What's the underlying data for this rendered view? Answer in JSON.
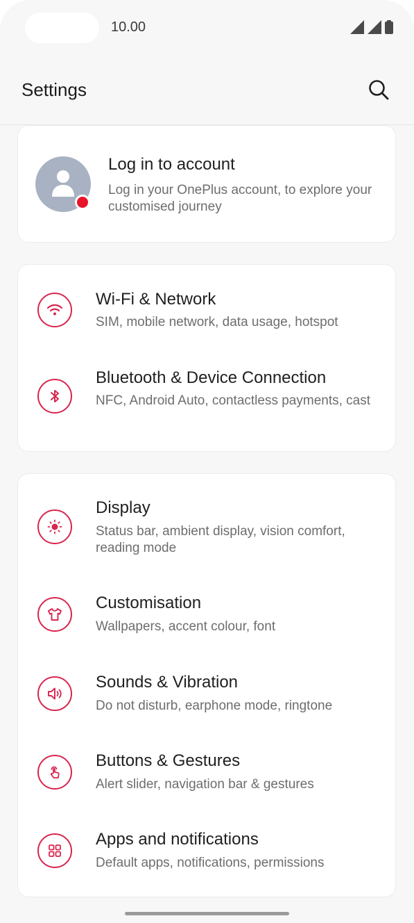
{
  "status_bar": {
    "time": "10.00"
  },
  "header": {
    "title": "Settings",
    "search_icon": "search-icon"
  },
  "account": {
    "title": "Log in to account",
    "subtitle": "Log in your OnePlus account, to explore your customised journey",
    "dot_color": "#e8142a"
  },
  "accent_color": "#d8264f",
  "network_group": [
    {
      "icon": "wifi-icon",
      "title": "Wi-Fi & Network",
      "subtitle": "SIM, mobile network, data usage, hotspot"
    },
    {
      "icon": "bluetooth-icon",
      "title": "Bluetooth & Device Connection",
      "subtitle": "NFC, Android Auto, contactless payments, cast"
    }
  ],
  "main_group": [
    {
      "icon": "display-brightness-icon",
      "title": "Display",
      "subtitle": "Status bar, ambient display, vision comfort, reading mode"
    },
    {
      "icon": "shirt-icon",
      "title": "Customisation",
      "subtitle": "Wallpapers, accent colour, font"
    },
    {
      "icon": "speaker-icon",
      "title": "Sounds & Vibration",
      "subtitle": "Do not disturb, earphone mode, ringtone"
    },
    {
      "icon": "touch-gesture-icon",
      "title": "Buttons & Gestures",
      "subtitle": "Alert slider, navigation bar & gestures"
    },
    {
      "icon": "apps-grid-icon",
      "title": "Apps and notifications",
      "subtitle": "Default apps, notifications, permissions"
    }
  ]
}
